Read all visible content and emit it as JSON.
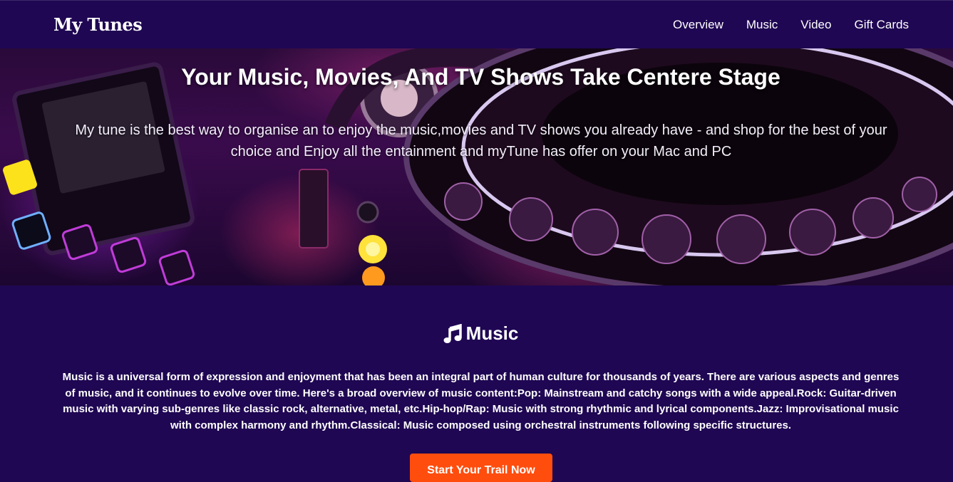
{
  "nav": {
    "brand": "My Tunes",
    "links": [
      "Overview",
      "Music",
      "Video",
      "Gift Cards"
    ]
  },
  "hero": {
    "title": "Your Music, Movies, And TV Shows Take Centere Stage",
    "text": "My tune is the best way to organise an to enjoy the music,movies and TV shows you already have - and shop for the best of your choice and Enjoy all the entainment and myTune has offer on your Mac and PC",
    "image_icon": "dj-turntable-image"
  },
  "music_section": {
    "icon": "music-note-icon",
    "heading": "Music",
    "text": "Music is a universal form of expression and enjoyment that has been an integral part of human culture for thousands of years. There are various aspects and genres of music, and it continues to evolve over time. Here's a broad overview of music content:Pop: Mainstream and catchy songs with a wide appeal.Rock: Guitar-driven music with varying sub-genres like classic rock, alternative, metal, etc.Hip-hop/Rap: Music with strong rhythmic and lyrical components.Jazz: Improvisational music with complex harmony and rhythm.Classical: Music composed using orchestral instruments following specific structures.",
    "button_label": "Start Your Trail Now"
  },
  "colors": {
    "background": "#1f0753",
    "button": "#ff4d0e",
    "text": "#ffffff"
  }
}
